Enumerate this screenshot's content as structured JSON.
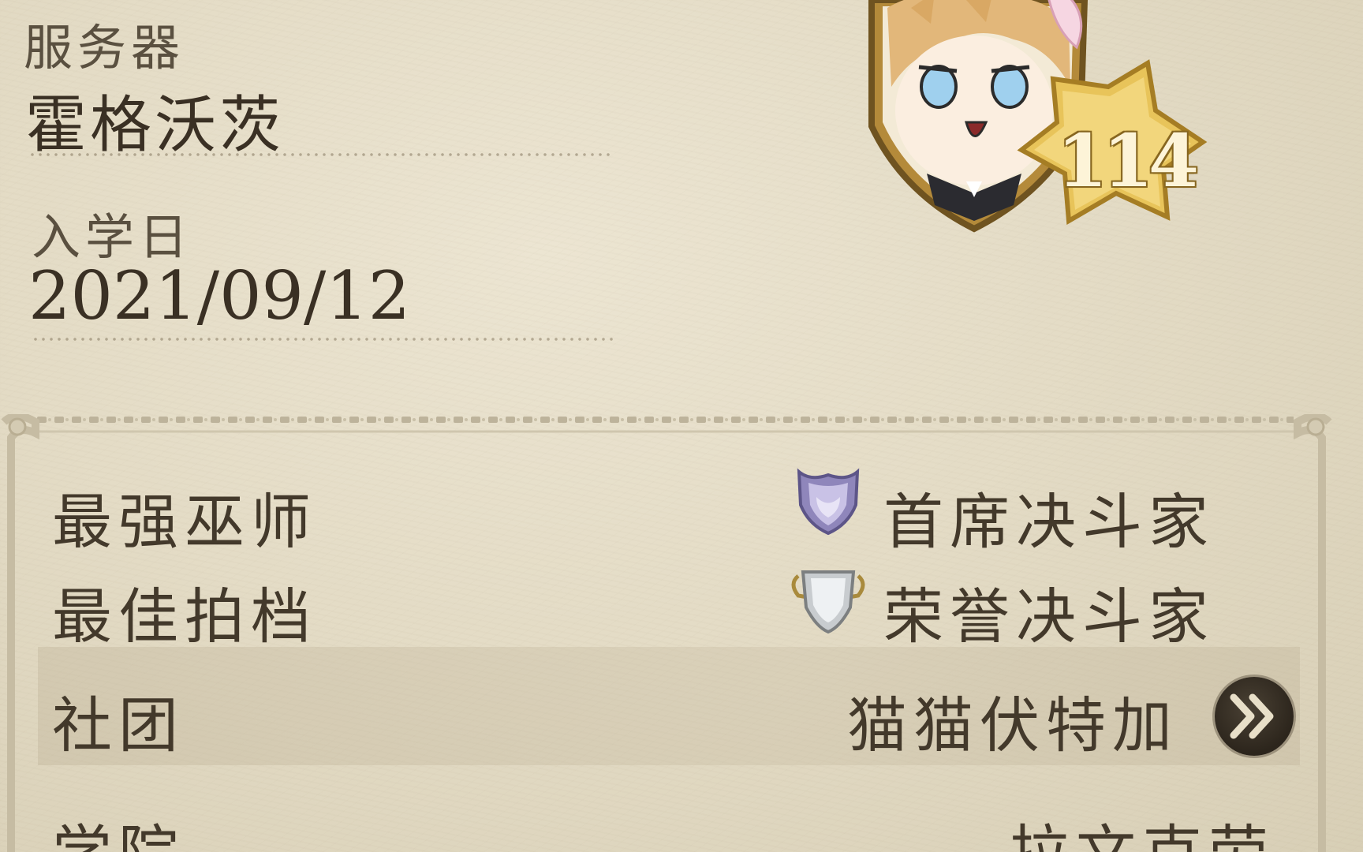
{
  "profile": {
    "server_label": "服务器",
    "server_value": "霍格沃茨",
    "enroll_label": "入学日",
    "enroll_value": "2021/09/12",
    "level": "114"
  },
  "stats": {
    "strongest_label": "最强巫师",
    "strongest_value": "首席决斗家",
    "partner_label": "最佳拍档",
    "partner_value": "荣誉决斗家",
    "club_label": "社团",
    "club_value": "猫猫伏特加",
    "house_label": "学院",
    "house_value": "拉文克劳"
  },
  "icons": {
    "strongest": "purple-shield-icon",
    "partner": "silver-trophy-icon",
    "club_arrow": "double-chevron-right-icon"
  },
  "colors": {
    "paper": "#e6dfca",
    "text": "#3f3628",
    "gold": "#d9b347",
    "purple": "#9b91c8"
  }
}
